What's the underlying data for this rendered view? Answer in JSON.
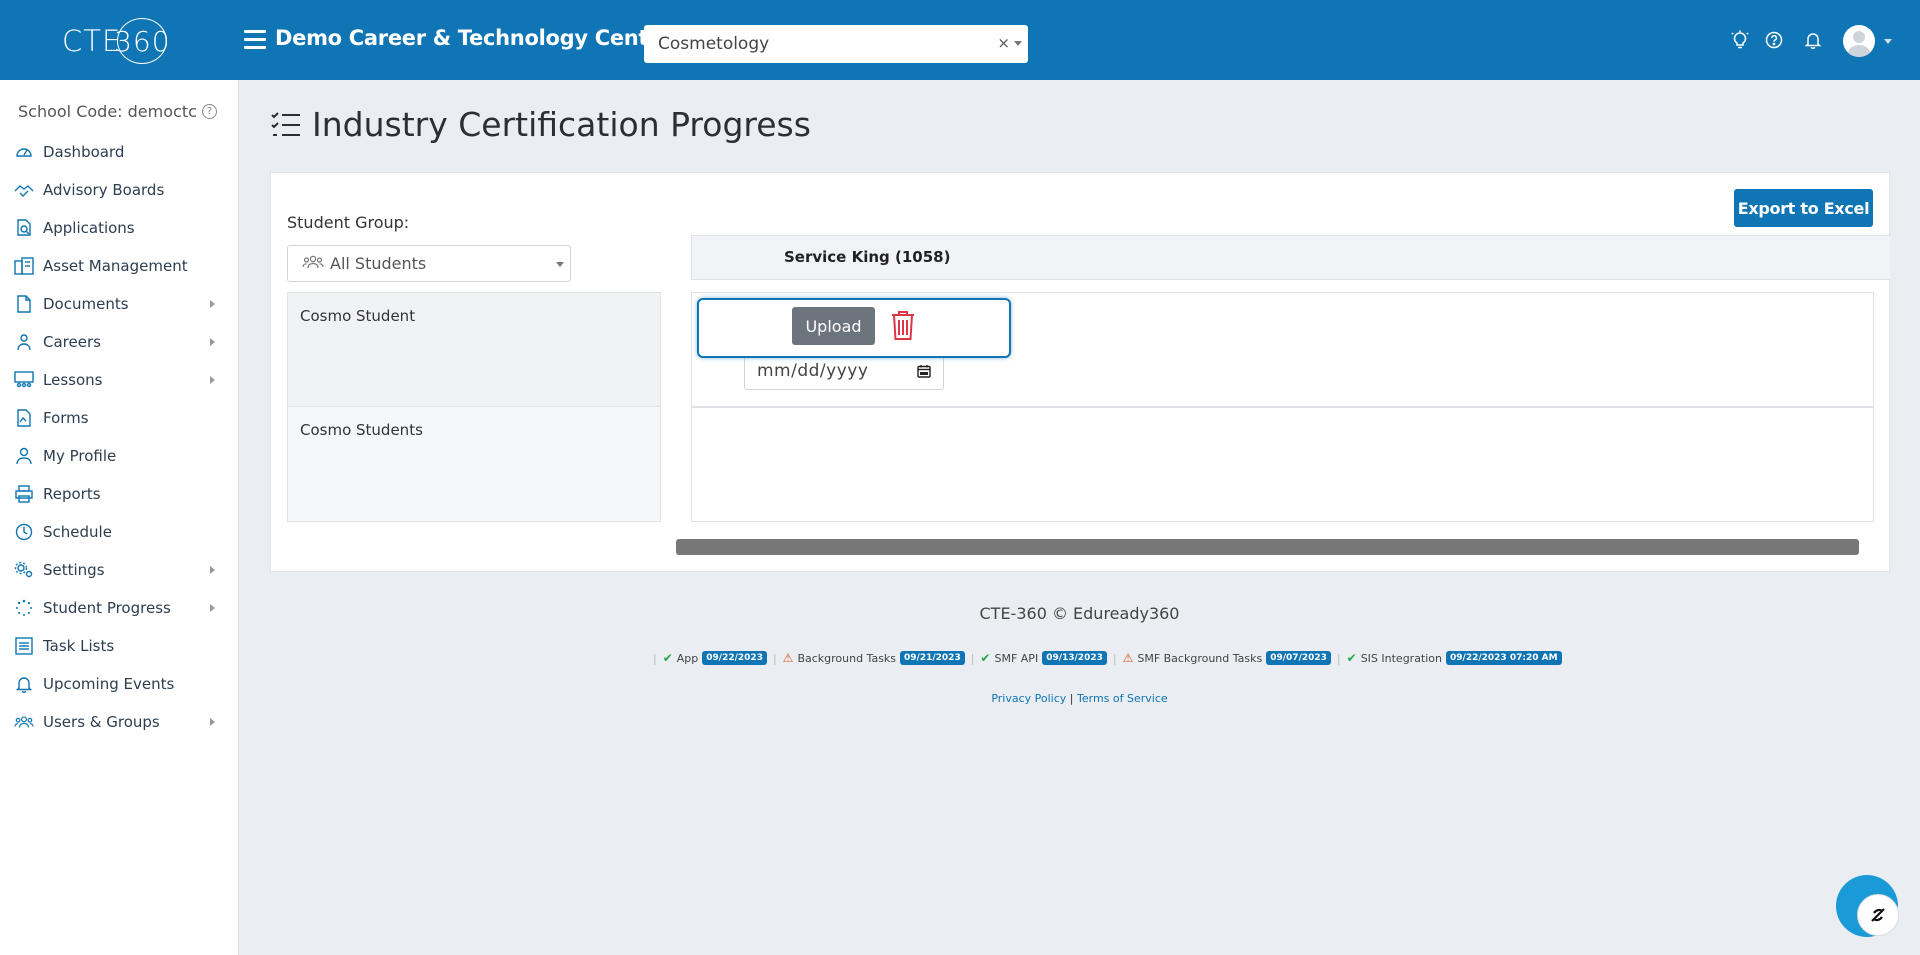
{
  "header": {
    "logo_text": "CTE",
    "logo_ring_text": "360",
    "org_title": "Demo Career & Technology Center",
    "program_select": {
      "value": "Cosmetology",
      "clear_symbol": "×"
    },
    "icons": [
      "lightbulb-icon",
      "help-icon",
      "bell-icon",
      "user-avatar-icon"
    ]
  },
  "sidebar": {
    "school_code": "School Code: democtc",
    "items": [
      {
        "label": "Dashboard",
        "icon": "dashboard-icon",
        "has_submenu": false
      },
      {
        "label": "Advisory Boards",
        "icon": "handshake-icon",
        "has_submenu": false
      },
      {
        "label": "Applications",
        "icon": "application-search-icon",
        "has_submenu": false
      },
      {
        "label": "Asset Management",
        "icon": "building-icon",
        "has_submenu": false
      },
      {
        "label": "Documents",
        "icon": "document-icon",
        "has_submenu": true
      },
      {
        "label": "Careers",
        "icon": "careers-icon",
        "has_submenu": true
      },
      {
        "label": "Lessons",
        "icon": "lessons-icon",
        "has_submenu": true
      },
      {
        "label": "Forms",
        "icon": "form-icon",
        "has_submenu": false
      },
      {
        "label": "My Profile",
        "icon": "person-icon",
        "has_submenu": false
      },
      {
        "label": "Reports",
        "icon": "printer-icon",
        "has_submenu": false
      },
      {
        "label": "Schedule",
        "icon": "clock-icon",
        "has_submenu": false
      },
      {
        "label": "Settings",
        "icon": "gears-icon",
        "has_submenu": true
      },
      {
        "label": "Student Progress",
        "icon": "spinner-icon",
        "has_submenu": true
      },
      {
        "label": "Task Lists",
        "icon": "list-icon",
        "has_submenu": false
      },
      {
        "label": "Upcoming Events",
        "icon": "bell-icon",
        "has_submenu": false
      },
      {
        "label": "Users & Groups",
        "icon": "users-icon",
        "has_submenu": true
      }
    ]
  },
  "main": {
    "page_title": "Industry Certification Progress",
    "export_label": "Export to Excel",
    "student_group_label": "Student Group:",
    "student_group_value": "All Students",
    "certification_header": "Service King (1058)",
    "students": [
      "Cosmo Student",
      "Cosmo Students"
    ],
    "upload_label": "Upload",
    "date_placeholder": "mm/dd/yyyy"
  },
  "footer": {
    "copyright": "CTE-360 © Eduready360",
    "statuses": [
      {
        "label": "App",
        "state": "ok",
        "date": "09/22/2023"
      },
      {
        "label": "Background Tasks",
        "state": "warn",
        "date": "09/21/2023"
      },
      {
        "label": "SMF API",
        "state": "ok",
        "date": "09/13/2023"
      },
      {
        "label": "SMF Background Tasks",
        "state": "warn",
        "date": "09/07/2023"
      },
      {
        "label": "SIS Integration",
        "state": "ok",
        "date": "09/22/2023 07:20 AM"
      }
    ],
    "privacy_label": "Privacy Policy",
    "separator": "|",
    "terms_label": "Terms of Service"
  },
  "colors": {
    "brand": "#0f75b4",
    "ok": "#28a745",
    "warn": "#d9531e",
    "danger": "#dc3545"
  }
}
